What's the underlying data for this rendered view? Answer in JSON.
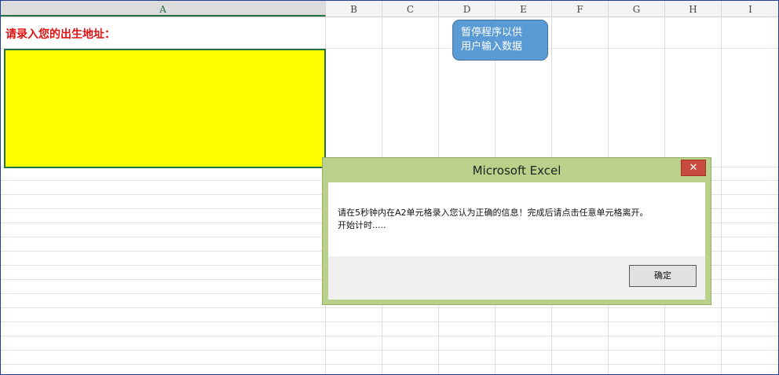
{
  "sheet": {
    "columns": [
      "A",
      "B",
      "C",
      "D",
      "E",
      "F",
      "G",
      "H",
      "I"
    ],
    "a1_text": "请录入您的出生地址：",
    "a2_fill_color": "#ffff00",
    "selected_column": "A"
  },
  "callout": {
    "line1": "暂停程序以供",
    "line2": "用户输入数据",
    "color": "#5b9bd5"
  },
  "dialog": {
    "title": "Microsoft Excel",
    "close_label": "✕",
    "message_line1": "请在5秒钟内在A2单元格录入您认为正确的信息！完成后请点击任意单元格离开。",
    "message_line2": "开始计时.....",
    "ok_label": "确定",
    "frame_color": "#b9d18a"
  }
}
